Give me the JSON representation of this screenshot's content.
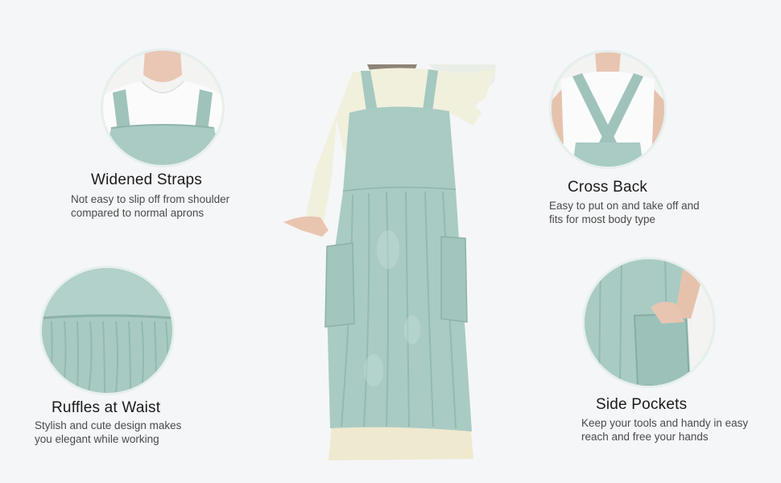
{
  "features": {
    "widened_straps": {
      "title": "Widened Straps",
      "desc_line1": "Not easy to slip off from shoulder",
      "desc_line2": "compared to normal aprons"
    },
    "cross_back": {
      "title": "Cross Back",
      "desc_line1": "Easy to put on and take off and",
      "desc_line2": "fits for most body type"
    },
    "ruffles_at_waist": {
      "title": "Ruffles at Waist",
      "desc_line1": "Stylish and cute design makes",
      "desc_line2": "you elegant while working"
    },
    "side_pockets": {
      "title": "Side Pockets",
      "desc_line1": "Keep your tools and handy in easy",
      "desc_line2": "reach and free your hands"
    }
  },
  "colors": {
    "background": "#f5f6f8",
    "apron_sage": "#a9cbc4",
    "blouse_cream": "#f1f0dc",
    "text_title": "#1b1b1b",
    "text_desc": "#4a4a4a"
  }
}
